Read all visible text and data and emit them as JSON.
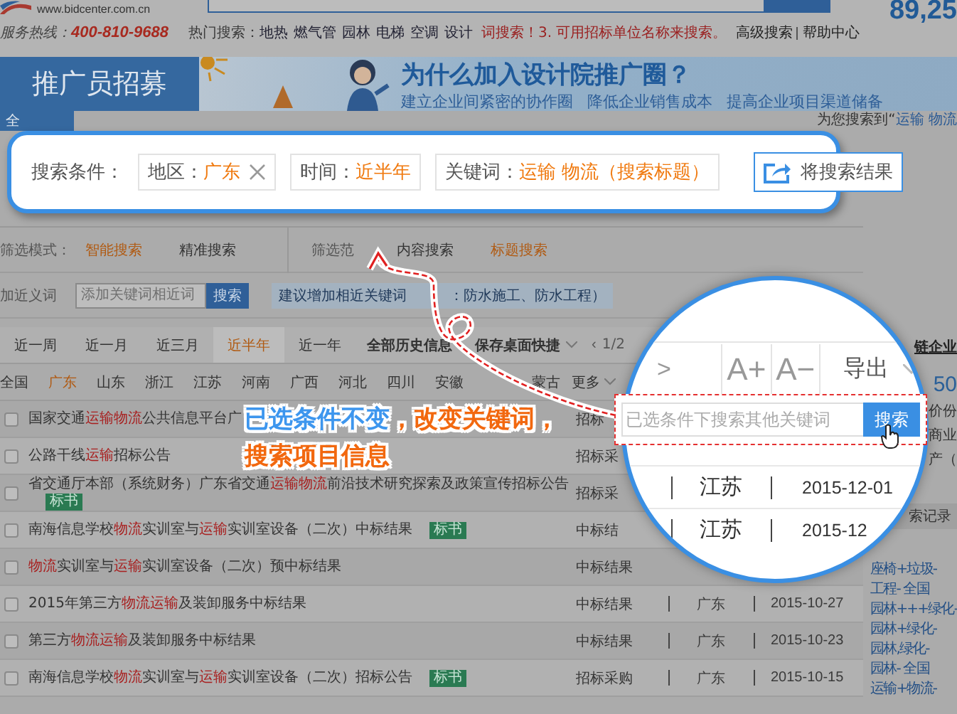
{
  "header": {
    "site_url": "www.bidcenter.com.cn",
    "hotline_label": "服务热线：",
    "hotline": "400-810-9688",
    "hot_label": "热门搜索：",
    "hot_terms": [
      "地热",
      "燃气管",
      "园林",
      "电梯",
      "空调",
      "设计"
    ],
    "tip": "词搜索！3. 可用招标单位名称来搜索。",
    "links": [
      "高级搜索",
      "帮助中心"
    ],
    "count": "89,25"
  },
  "banner": {
    "recruit": "推广员招募",
    "title": "为什么加入设计院推广圈？",
    "slogans": [
      "建立企业间紧密的协作圈",
      "降低企业销售成本",
      "提高企业项目渠道储备"
    ]
  },
  "result_bar": {
    "tab": "全",
    "summary_label": "为您搜索到“",
    "summary_query": "运输  物流"
  },
  "conditions": {
    "label": "搜索条件：",
    "chips": [
      {
        "key": "地区：",
        "value": "广东",
        "removable": true
      },
      {
        "key": "时间：",
        "value": "近半年",
        "removable": false
      },
      {
        "key": "关键词：",
        "value": "运输  物流（搜索标题）",
        "removable": false
      }
    ],
    "export_button": "将搜索结果"
  },
  "filters": {
    "mode_label": "筛选模式：",
    "modes": [
      {
        "label": "智能搜索",
        "selected": true
      },
      {
        "label": "精准搜索",
        "selected": false
      }
    ],
    "scope_label": "筛选范",
    "scopes": [
      {
        "label": "内容搜索",
        "selected": false
      },
      {
        "label": "标题搜索",
        "selected": true
      }
    ],
    "synonym_label": "加近义词",
    "synonym_placeholder": "添加关键词相近词",
    "synonym_button": "搜索",
    "synonym_hint": [
      "建议增加相近关键词",
      "：防水施工、防水工程）"
    ]
  },
  "time_tabs": [
    {
      "label": "近一周",
      "selected": false
    },
    {
      "label": "近一月",
      "selected": false
    },
    {
      "label": "近三月",
      "selected": false
    },
    {
      "label": "近半年",
      "selected": true
    },
    {
      "label": "近一年",
      "selected": false
    },
    {
      "label": "全部历史信息",
      "selected": false
    }
  ],
  "save_shortcut": "保存桌面快捷",
  "pager": {
    "prev": "‹",
    "page": "1/2"
  },
  "regions": [
    {
      "label": "全国",
      "selected": false
    },
    {
      "label": "广东",
      "selected": true
    },
    {
      "label": "山东",
      "selected": false
    },
    {
      "label": "浙江",
      "selected": false
    },
    {
      "label": "江苏",
      "selected": false
    },
    {
      "label": "河南",
      "selected": false
    },
    {
      "label": "广西",
      "selected": false
    },
    {
      "label": "河北",
      "selected": false
    },
    {
      "label": "四川",
      "selected": false
    },
    {
      "label": "安徽",
      "selected": false
    },
    {
      "label": "蒙古",
      "selected": false
    }
  ],
  "more_regions": "更多",
  "results": [
    {
      "title": "国家交通**运输物流**公共信息平台广",
      "type": "招标",
      "checked": false
    },
    {
      "title": "公路干线**运输**招标公告",
      "type": "招标采",
      "checked": false
    },
    {
      "title": "省交通厅本部（系统财务）广东省交通**运输物流**前沿技术研究探索及政策宣传招标公告",
      "tag": "标书",
      "type": "招标采",
      "checked": false
    },
    {
      "title": "南海信息学校**物流**实训室与**运输**实训室设备（二次）中标结果",
      "tag": "标书",
      "type": "中标结",
      "checked": false
    },
    {
      "title": "**物流**实训室与**运输**实训室设备（二次）预中标结果",
      "type": "中标结果",
      "checked": false
    },
    {
      "title": "2015年第三方**物流运输**及装卸服务中标结果",
      "type": "中标结果",
      "region": "广东",
      "date": "2015-10-27",
      "checked": false
    },
    {
      "title": "第三方**物流运输**及装卸服务中标结果",
      "type": "中标结果",
      "region": "广东",
      "date": "2015-10-23",
      "checked": false
    },
    {
      "title": "南海信息学校**物流**实训室与**运输**实训室设备（二次）招标公告",
      "tag": "标书",
      "type": "招标采购",
      "region": "广东",
      "date": "2015-10-15",
      "checked": false
    }
  ],
  "sidebar": {
    "heading": "链企业",
    "count": "50",
    "lines": [
      "价份",
      "商业",
      "产（"
    ],
    "history_heading": "索记录",
    "history": [
      "座椅+垃圾-",
      "工程- 全国",
      "园林+++绿化-",
      "园林+绿化-",
      "园林,绿化-",
      "园林- 全国",
      "运输+物流-"
    ]
  },
  "magnifier": {
    "next": ">",
    "font_up": "A+",
    "font_down": "A−",
    "export": "导出",
    "rows": [
      {
        "region": "江苏",
        "date": "2015-12-01"
      },
      {
        "region": "江苏",
        "date": "2015-12"
      }
    ]
  },
  "search_callout": {
    "placeholder": "已选条件下搜索其他关键词",
    "button": "搜索"
  },
  "note": {
    "lines": [
      [
        {
          "text": "已选条件不变",
          "color": "#3d96ee"
        },
        {
          "text": "，改变关键词，",
          "color": "#f2680f"
        }
      ],
      [
        {
          "text": "搜索项目信息",
          "color": "#f2680f"
        }
      ]
    ]
  }
}
